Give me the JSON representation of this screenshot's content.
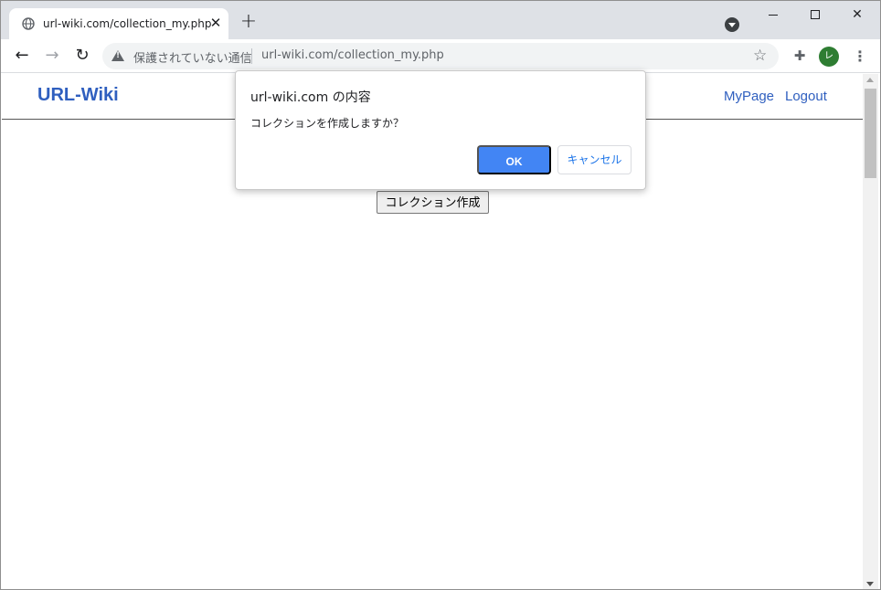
{
  "browser": {
    "tab": {
      "title": "url-wiki.com/collection_my.php",
      "close": "✕"
    },
    "new_tab": "+",
    "omnibox": {
      "security_label": "保護されていない通信",
      "url": "url-wiki.com/collection_my.php"
    },
    "avatar_initial": "レ"
  },
  "site": {
    "logo": "URL-Wiki",
    "nav": {
      "mypage": "MyPage",
      "logout": "Logout"
    },
    "create_button": "コレクション作成"
  },
  "dialog": {
    "title": "url-wiki.com の内容",
    "message": "コレクションを作成しますか？",
    "ok_label": "OK",
    "cancel_label": "キャンセル"
  },
  "colors": {
    "accent": "#4285f4",
    "link": "#2f5fbf",
    "avatar": "#2e7d32"
  },
  "icons": [
    "globe-icon",
    "close-icon",
    "plus-icon",
    "tab-search-icon",
    "back-arrow-icon",
    "forward-arrow-icon",
    "reload-icon",
    "warning-icon",
    "star-icon",
    "extensions-icon",
    "kebab-menu-icon"
  ]
}
